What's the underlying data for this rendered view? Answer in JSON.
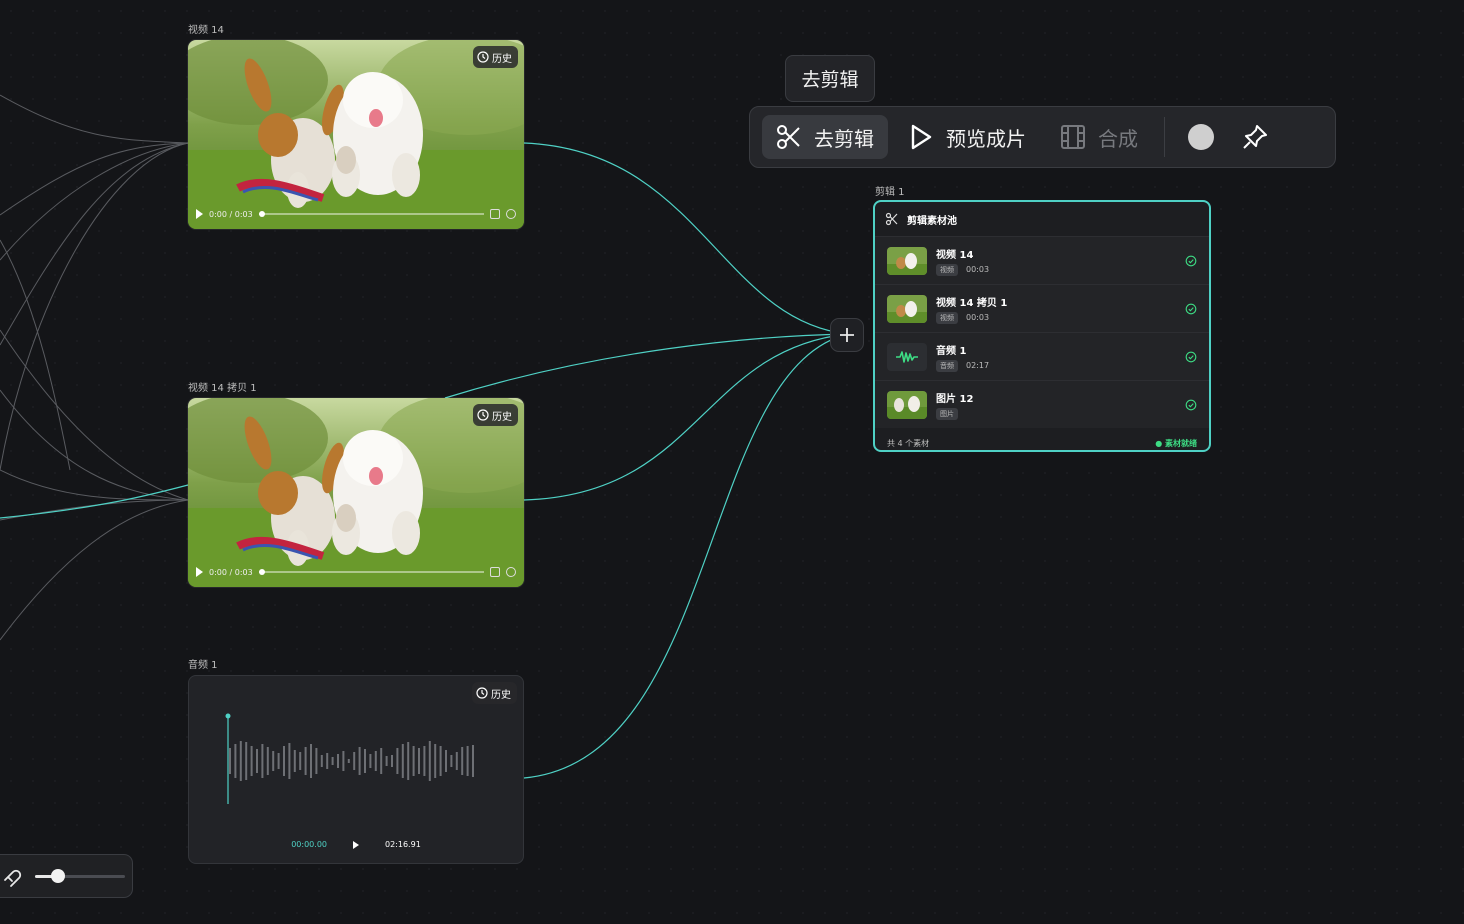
{
  "nodes": {
    "video1": {
      "label": "视频 14",
      "history": "历史",
      "time": "0:00 / 0:03"
    },
    "video2": {
      "label": "视频 14 拷贝 1",
      "history": "历史",
      "time": "0:00 / 0:03"
    },
    "audio": {
      "label": "音频 1",
      "history": "历史",
      "current_time": "00:00.00",
      "total_time": "02:16.91"
    }
  },
  "tooltip": "去剪辑",
  "toolbar": {
    "edit": "去剪辑",
    "preview": "预览成片",
    "compose": "合成"
  },
  "pool": {
    "node_label": "剪辑 1",
    "title": "剪辑素材池",
    "items": [
      {
        "name": "视频 14",
        "type": "视频",
        "duration": "00:03"
      },
      {
        "name": "视频 14 拷贝 1",
        "type": "视频",
        "duration": "00:03"
      },
      {
        "name": "音频 1",
        "type": "音频",
        "duration": "02:17"
      },
      {
        "name": "图片 12",
        "type": "图片",
        "duration": ""
      }
    ],
    "count_text": "共 4 个素材",
    "status": "素材就绪"
  },
  "zoom": {
    "level": 0.25
  },
  "colors": {
    "accent": "#4fd1c5",
    "ready": "#3ddc84",
    "background": "#141518"
  }
}
